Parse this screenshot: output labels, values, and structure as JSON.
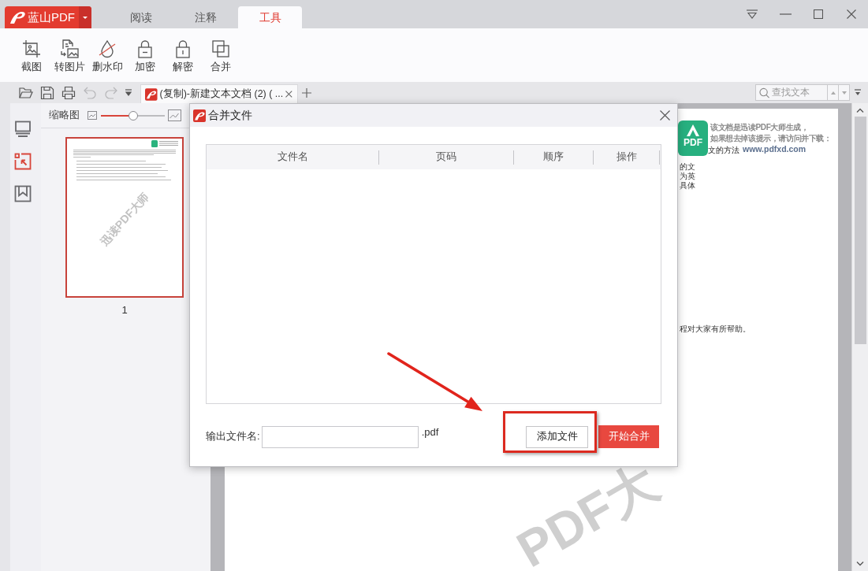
{
  "app": {
    "logo_text": "蓝山PDF"
  },
  "menu_tabs": [
    {
      "label": "阅读",
      "selected": false
    },
    {
      "label": "注释",
      "selected": false
    },
    {
      "label": "工具",
      "selected": true
    }
  ],
  "ribbon_tools": [
    {
      "label": "截图",
      "kind": "screenshot"
    },
    {
      "label": "转图片",
      "kind": "to_image"
    },
    {
      "label": "删水印",
      "kind": "remove_watermark"
    },
    {
      "label": "加密",
      "kind": "encrypt"
    },
    {
      "label": "解密",
      "kind": "decrypt"
    },
    {
      "label": "合并",
      "kind": "merge"
    }
  ],
  "quick_toolbar": [
    {
      "kind": "open",
      "disabled": false
    },
    {
      "kind": "save",
      "disabled": false
    },
    {
      "kind": "print",
      "disabled": false
    },
    {
      "kind": "undo",
      "disabled": true
    },
    {
      "kind": "redo",
      "disabled": true
    },
    {
      "kind": "customize",
      "disabled": false
    }
  ],
  "document_tab": {
    "title": "(复制)-新建文本文档 (2) ( ..."
  },
  "search": {
    "placeholder": "查找文本"
  },
  "side_rail": [
    {
      "kind": "pages",
      "selected": false
    },
    {
      "kind": "thumbnails",
      "selected": true
    },
    {
      "kind": "bookmarks",
      "selected": false
    }
  ],
  "thumbnail_panel": {
    "title": "缩略图",
    "zoom": {
      "level": 0.5
    },
    "pages": [
      {
        "number": "1",
        "selected": true,
        "watermark": "迅读PDF大师"
      }
    ]
  },
  "document": {
    "logo_text": "PDF",
    "notice": [
      "该文档是迅读PDF大师生成，",
      "如果想去掉该提示，请访问并下载："
    ],
    "heading": "文的方法",
    "url": "www.pdfxd.com",
    "lines": [
      "的文",
      "为英",
      "具体"
    ],
    "closing": "程对大家有所帮助。",
    "watermark": "PDF大"
  },
  "dialog": {
    "title": "合并文件",
    "columns": [
      "文件名",
      "页码",
      "顺序",
      "操作"
    ],
    "output_label": "输出文件名:",
    "extension": ".pdf",
    "buttons": [
      {
        "label": "添加文件",
        "kind": "secondary"
      },
      {
        "label": "开始合并",
        "kind": "primary"
      }
    ]
  }
}
